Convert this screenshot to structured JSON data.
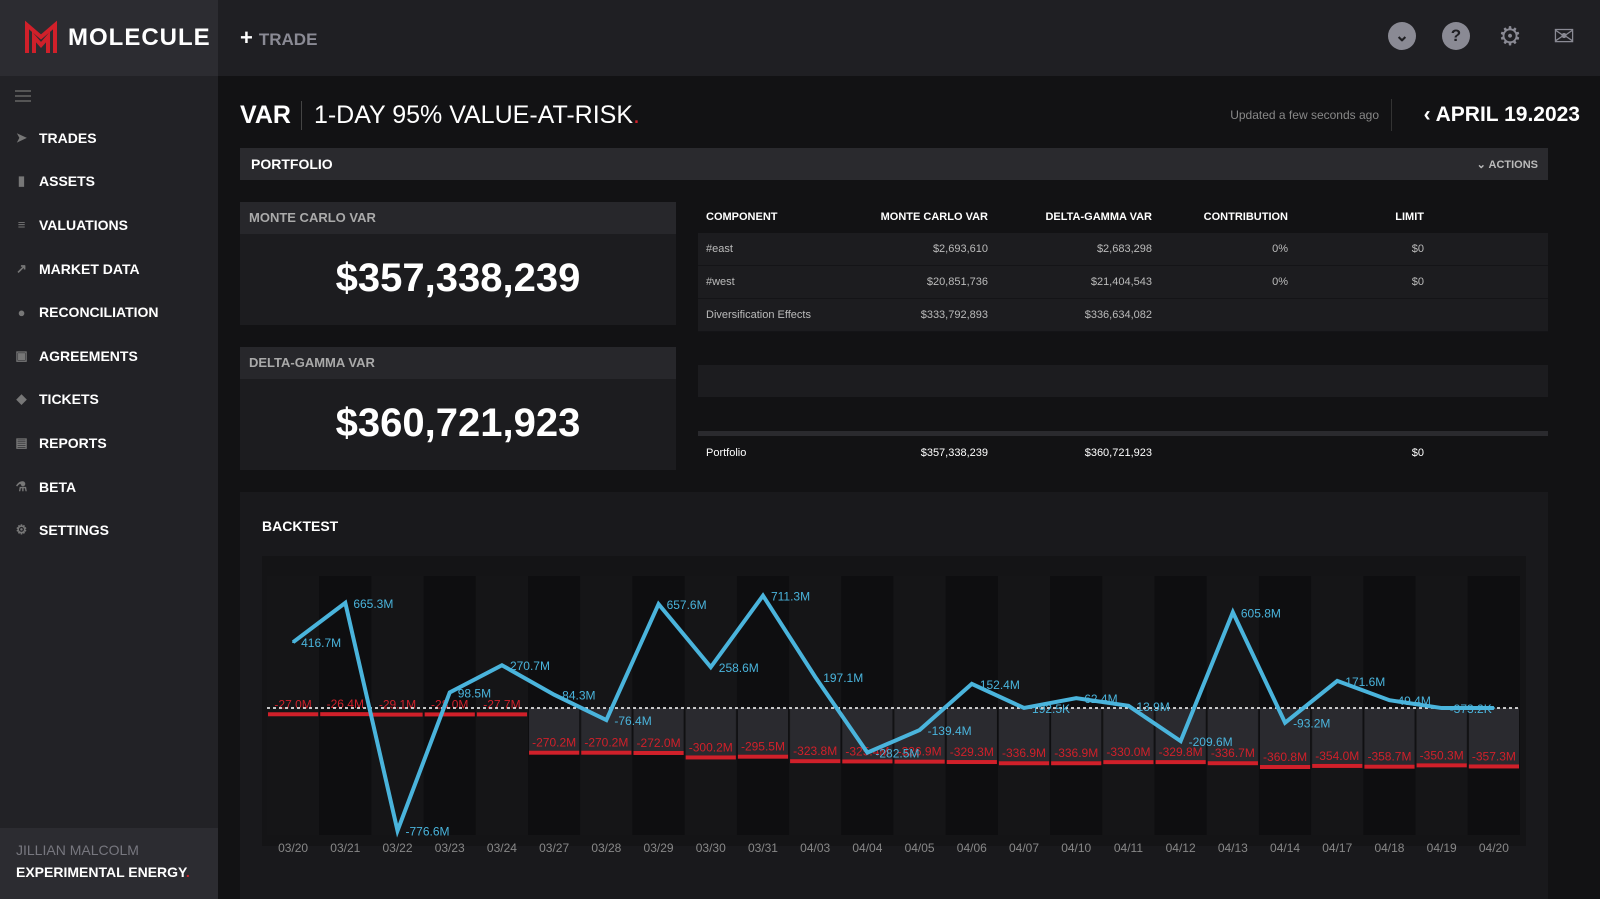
{
  "app": {
    "brand": "MOLECULE",
    "trade_button": "TRADE"
  },
  "sidebar": {
    "items": [
      {
        "label": "TRADES",
        "icon": "paper-plane-icon"
      },
      {
        "label": "ASSETS",
        "icon": "bar-chart-icon"
      },
      {
        "label": "VALUATIONS",
        "icon": "sliders-icon"
      },
      {
        "label": "MARKET DATA",
        "icon": "line-chart-icon"
      },
      {
        "label": "RECONCILIATION",
        "icon": "check-circle-icon"
      },
      {
        "label": "AGREEMENTS",
        "icon": "documents-icon"
      },
      {
        "label": "TICKETS",
        "icon": "ticket-icon"
      },
      {
        "label": "REPORTS",
        "icon": "file-icon"
      },
      {
        "label": "BETA",
        "icon": "flask-icon"
      },
      {
        "label": "SETTINGS",
        "icon": "gear-icon"
      }
    ],
    "user": {
      "name": "JILLIAN MALCOLM",
      "company": "EXPERIMENTAL ENERGY"
    }
  },
  "header": {
    "title": "VAR",
    "subtitle": "1-DAY 95% VALUE-AT-RISK",
    "updated": "Updated a few seconds ago",
    "date": "APRIL 19.2023"
  },
  "portfolio": {
    "label": "PORTFOLIO",
    "actions": "ACTIONS",
    "monte_carlo": {
      "label": "MONTE CARLO VAR",
      "value": "$357,338,239"
    },
    "delta_gamma": {
      "label": "DELTA-GAMMA VAR",
      "value": "$360,721,923"
    },
    "table": {
      "columns": [
        "COMPONENT",
        "MONTE CARLO VAR",
        "DELTA-GAMMA VAR",
        "CONTRIBUTION",
        "LIMIT"
      ],
      "rows": [
        [
          "#east",
          "$2,693,610",
          "$2,683,298",
          "0%",
          "$0"
        ],
        [
          "#west",
          "$20,851,736",
          "$21,404,543",
          "0%",
          "$0"
        ],
        [
          "Diversification Effects",
          "$333,792,893",
          "$336,634,082",
          "",
          ""
        ]
      ],
      "total": [
        "Portfolio",
        "$357,338,239",
        "$360,721,923",
        "",
        "$0"
      ]
    }
  },
  "chart_data": {
    "type": "line+bar",
    "title": "BACKTEST",
    "units": "M USD",
    "categories": [
      "03/20",
      "03/21",
      "03/22",
      "03/23",
      "03/24",
      "03/27",
      "03/28",
      "03/29",
      "03/30",
      "03/31",
      "04/03",
      "04/04",
      "04/05",
      "04/06",
      "04/07",
      "04/10",
      "04/11",
      "04/12",
      "04/13",
      "04/14",
      "04/17",
      "04/18",
      "04/19",
      "04/20"
    ],
    "series": [
      {
        "kind": "line",
        "color": "#4ab4dc",
        "values": [
          416.7,
          665.3,
          -776.6,
          98.5,
          270.7,
          84.3,
          -76.4,
          657.6,
          258.6,
          711.3,
          197.1,
          -282.5,
          -139.4,
          152.4,
          0.1925,
          62.4,
          13.9,
          -209.6,
          605.8,
          -93.2,
          171.6,
          49.4,
          -0.3732,
          -0.3732
        ],
        "labels": [
          "416.7M",
          "665.3M",
          "-776.6M",
          "98.5M",
          "270.7M",
          "84.3M",
          "-76.4M",
          "657.6M",
          "258.6M",
          "711.3M",
          "197.1M",
          "-282.5M",
          "-139.4M",
          "152.4M",
          "192.5K",
          "62.4M",
          "13.9M",
          "-209.6M",
          "605.8M",
          "-93.2M",
          "171.6M",
          "49.4M",
          "-373.2K",
          ""
        ]
      },
      {
        "kind": "bar",
        "color": "#d0202a",
        "values": [
          -27.0,
          -26.4,
          -29.1,
          -28.0,
          -27.7,
          -270.2,
          -270.2,
          -272.0,
          -300.2,
          -295.5,
          -323.8,
          -325.4,
          -326.9,
          -329.3,
          -336.9,
          -336.9,
          -330.0,
          -329.8,
          -336.7,
          -360.8,
          -354.0,
          -358.7,
          -350.3,
          -357.3
        ],
        "labels": [
          "-27.0M",
          "-26.4M",
          "-29.1M",
          "-28.0M",
          "-27.7M",
          "-270.2M",
          "-270.2M",
          "-272.0M",
          "-300.2M",
          "-295.5M",
          "-323.8M",
          "-325.4M",
          "-326.9M",
          "-329.3M",
          "-336.9M",
          "-336.9M",
          "-330.0M",
          "-329.8M",
          "-336.7M",
          "-360.8M",
          "-354.0M",
          "-358.7M",
          "-350.3M",
          "-357.3M"
        ]
      }
    ],
    "zero_line": "dashed"
  }
}
